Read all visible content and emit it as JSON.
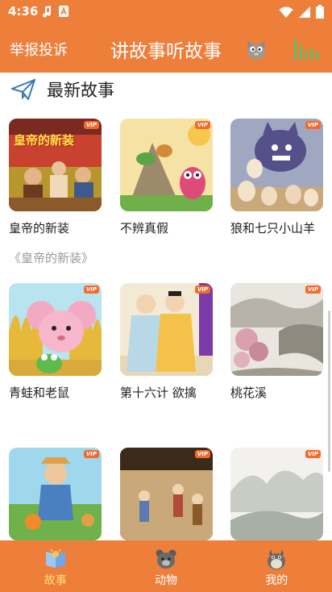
{
  "status": {
    "time": "4:36",
    "icons": [
      "music-note-icon",
      "font-icon",
      "wifi-icon",
      "signal-icon",
      "battery-icon"
    ]
  },
  "header": {
    "report_label": "举报投诉",
    "title": "讲故事听故事",
    "icons": [
      "cat-icon",
      "equalizer-icon"
    ]
  },
  "section": {
    "title": "最新故事",
    "icon": "paper-plane-icon"
  },
  "vip_label": "VIP",
  "stories": [
    {
      "title": "皇帝的新装",
      "subtitle": "《皇帝的新装》",
      "cover_text": "皇帝的新装"
    },
    {
      "title": "不辨真假",
      "subtitle": ""
    },
    {
      "title": "狼和七只小山羊",
      "subtitle": ""
    },
    {
      "title": "青蛙和老鼠",
      "subtitle": ""
    },
    {
      "title": "第十六计 欲擒",
      "subtitle": ""
    },
    {
      "title": "桃花溪",
      "subtitle": ""
    },
    {
      "title": "",
      "subtitle": ""
    },
    {
      "title": "",
      "subtitle": ""
    },
    {
      "title": "",
      "subtitle": ""
    }
  ],
  "nav": {
    "items": [
      {
        "label": "故事",
        "icon": "book-icon",
        "active": true
      },
      {
        "label": "动物",
        "icon": "bear-icon",
        "active": false
      },
      {
        "label": "我的",
        "icon": "totoro-icon",
        "active": false
      }
    ]
  },
  "colors": {
    "primary": "#ee7f3b",
    "nav_active": "#ffe07a",
    "vip": "#f46a2a"
  }
}
